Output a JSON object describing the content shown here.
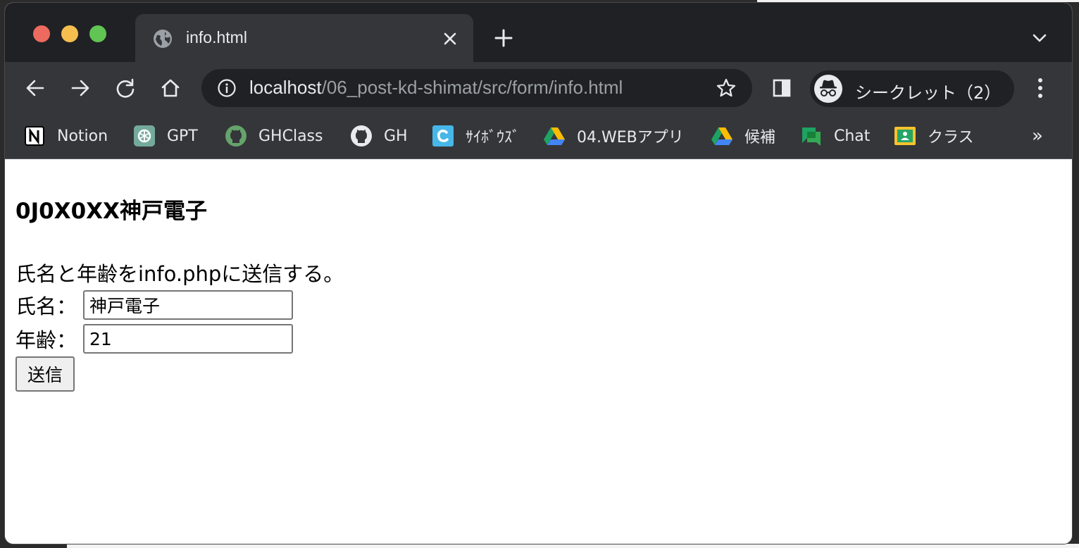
{
  "browser": {
    "tab": {
      "title": "info.html"
    },
    "address_bar": {
      "host": "localhost",
      "path": "/06_post-kd-shimat/src/form/info.html"
    },
    "profile": {
      "label": "シークレット（2）"
    },
    "bookmarks": [
      {
        "label": "Notion",
        "icon": "notion-icon"
      },
      {
        "label": "GPT",
        "icon": "chatgpt-icon"
      },
      {
        "label": "GHClass",
        "icon": "github-icon"
      },
      {
        "label": "GH",
        "icon": "github-icon"
      },
      {
        "label": "ｻｲﾎﾞｳｽﾞ",
        "icon": "cybozu-icon"
      },
      {
        "label": "04.WEBアプリ",
        "icon": "google-drive-icon"
      },
      {
        "label": "候補",
        "icon": "google-drive-icon"
      },
      {
        "label": "Chat",
        "icon": "google-chat-icon"
      },
      {
        "label": "クラス",
        "icon": "google-classroom-icon"
      }
    ],
    "bookmarks_overflow": "»"
  },
  "page": {
    "heading": "0J0X0XX神戸電子",
    "intro": "氏名と年齢をinfo.phpに送信する。",
    "fields": [
      {
        "label": "氏名：",
        "value": "神戸電子"
      },
      {
        "label": "年齢：",
        "value": "21"
      }
    ],
    "submit_label": "送信"
  },
  "colors": {
    "tabstrip_bg": "#202124",
    "toolbar_bg": "#35363a",
    "text_light": "#e8eaed",
    "text_muted": "#9aa0a6"
  }
}
